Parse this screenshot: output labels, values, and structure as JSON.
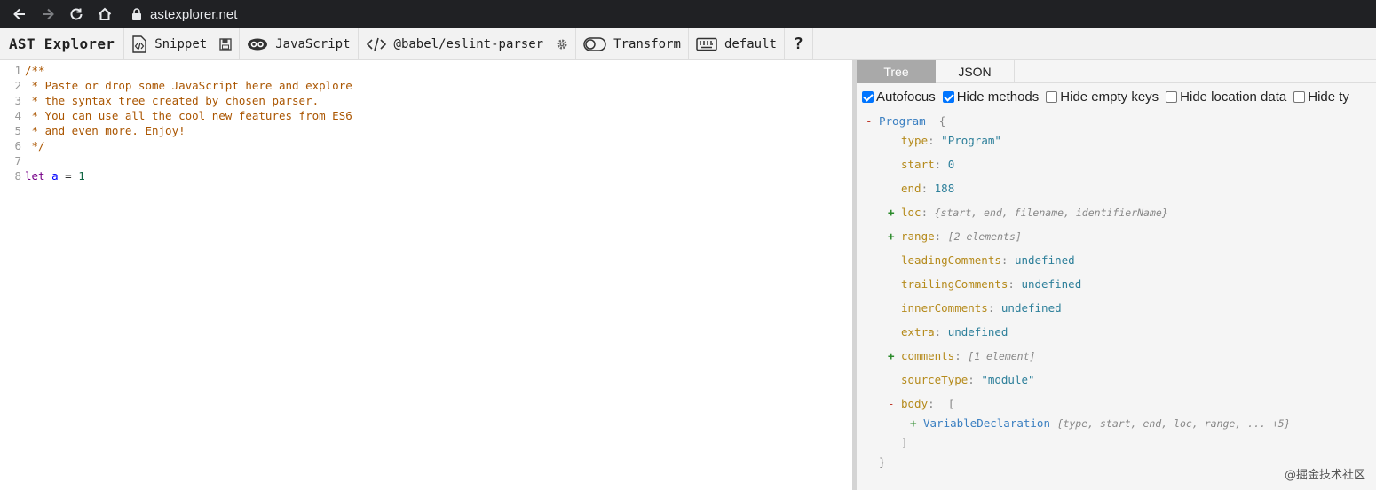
{
  "browser": {
    "url": "astexplorer.net"
  },
  "toolbar": {
    "brand": "AST Explorer",
    "snippet_label": "Snippet",
    "language_label": "JavaScript",
    "parser_label": "@babel/eslint-parser",
    "transform_label": "Transform",
    "keymap_label": "default",
    "help_label": "?"
  },
  "editor": {
    "lines": [
      {
        "num": "1",
        "text": "/**"
      },
      {
        "num": "2",
        "text": " * Paste or drop some JavaScript here and explore"
      },
      {
        "num": "3",
        "text": " * the syntax tree created by chosen parser."
      },
      {
        "num": "4",
        "text": " * You can use all the cool new features from ES6"
      },
      {
        "num": "5",
        "text": " * and even more. Enjoy!"
      },
      {
        "num": "6",
        "text": " */"
      },
      {
        "num": "7",
        "text": ""
      },
      {
        "num": "8",
        "kw": "let",
        "var": "a",
        "op": "=",
        "num_value": "1"
      }
    ]
  },
  "output": {
    "tabs": [
      {
        "label": "Tree",
        "active": true
      },
      {
        "label": "JSON",
        "active": false
      }
    ],
    "options": [
      {
        "label": "Autofocus",
        "checked": true
      },
      {
        "label": "Hide methods",
        "checked": true
      },
      {
        "label": "Hide empty keys",
        "checked": false
      },
      {
        "label": "Hide location data",
        "checked": false
      },
      {
        "label": "Hide ty",
        "checked": false
      }
    ],
    "tree": {
      "root_toggle": "-",
      "root_type": "Program",
      "root_open": "{",
      "root_close": "}",
      "type": {
        "key": "type",
        "value": "\"Program\""
      },
      "start": {
        "key": "start",
        "value": "0"
      },
      "end": {
        "key": "end",
        "value": "188"
      },
      "loc": {
        "toggle": "+",
        "key": "loc",
        "summary": "{start, end, filename, identifierName}"
      },
      "range": {
        "toggle": "+",
        "key": "range",
        "summary": "[2 elements]"
      },
      "leadingComments": {
        "key": "leadingComments",
        "value": "undefined"
      },
      "trailingComments": {
        "key": "trailingComments",
        "value": "undefined"
      },
      "innerComments": {
        "key": "innerComments",
        "value": "undefined"
      },
      "extra": {
        "key": "extra",
        "value": "undefined"
      },
      "comments": {
        "toggle": "+",
        "key": "comments",
        "summary": "[1 element]"
      },
      "sourceType": {
        "key": "sourceType",
        "value": "\"module\""
      },
      "body": {
        "toggle": "-",
        "key": "body",
        "open": "[",
        "close": "]"
      },
      "variableDeclaration": {
        "toggle": "+",
        "type": "VariableDeclaration",
        "summary": "{type, start, end, loc, range, ... +5}"
      }
    }
  },
  "watermark": "@掘金技术社区"
}
